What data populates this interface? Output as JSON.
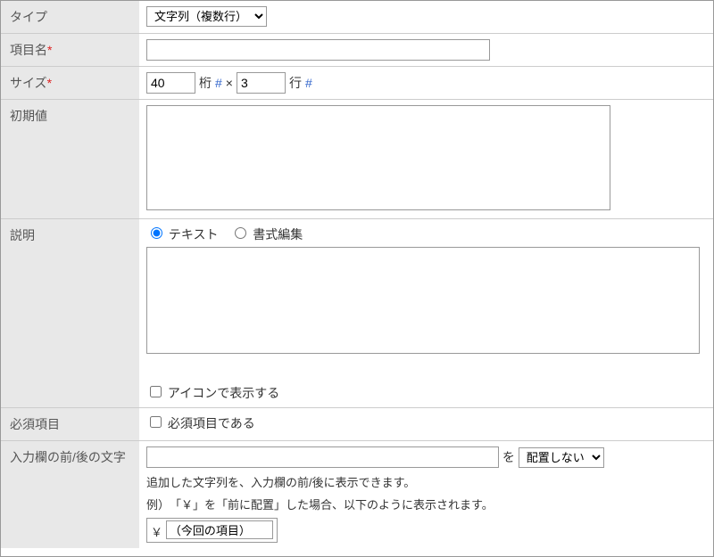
{
  "labels": {
    "type": "タイプ",
    "name": "項目名",
    "size": "サイズ",
    "initial": "初期値",
    "desc": "説明",
    "required": "必須項目",
    "surround": "入力欄の前/後の文字"
  },
  "type_select": {
    "selected": "文字列（複数行）"
  },
  "name_value": "",
  "size": {
    "cols_value": "40",
    "cols_label": "桁",
    "times": "×",
    "rows_value": "3",
    "rows_label": "行",
    "hash": "#"
  },
  "initial_value": "",
  "desc": {
    "radio_text": "テキスト",
    "radio_rich": "書式編集",
    "textarea_value": "",
    "icon_checkbox_label": "アイコンで表示する"
  },
  "required_checkbox_label": "必須項目である",
  "surround": {
    "input_value": "",
    "wo": "を",
    "place_selected": "配置しない",
    "help1": "追加した文字列を、入力欄の前/後に表示できます。",
    "help2": "例）　「￥」を「前に配置」した場合、以下のように表示されます。",
    "yen": "￥",
    "demo_placeholder": "（今回の項目）"
  }
}
